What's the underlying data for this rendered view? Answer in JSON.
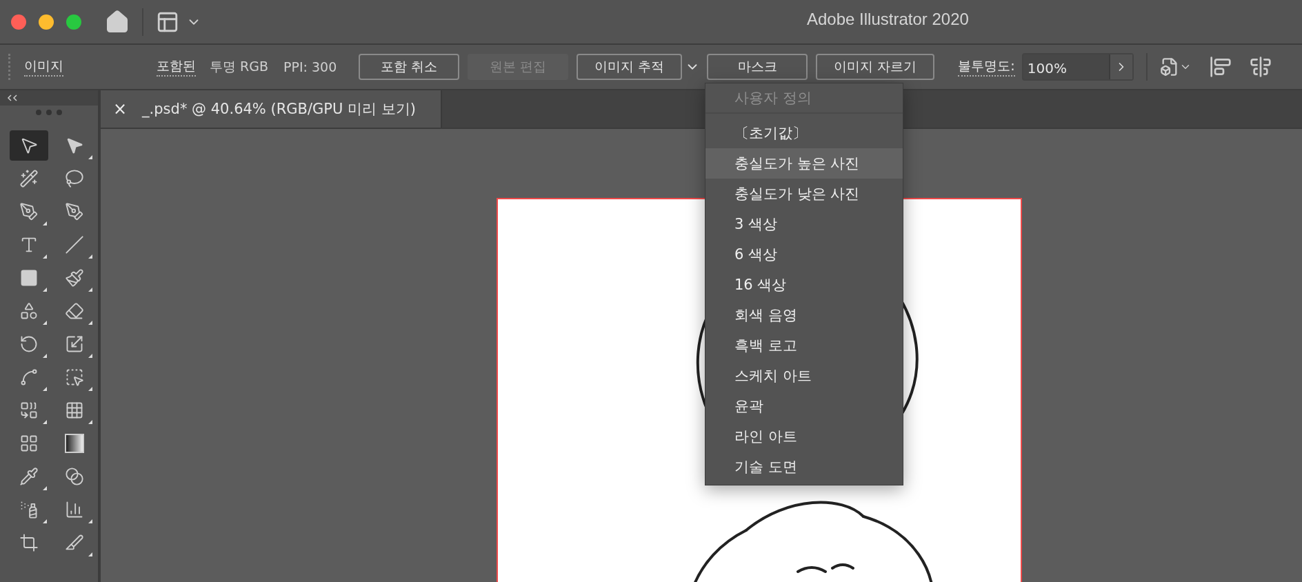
{
  "window": {
    "title": "Adobe Illustrator 2020"
  },
  "control_bar": {
    "label": "이미지",
    "status": "포함된",
    "color_mode": "투명 RGB",
    "ppi": "PPI: 300",
    "buttons": [
      {
        "label": "포함 취소",
        "disabled": false,
        "has_menu": false
      },
      {
        "label": "원본 편집",
        "disabled": true,
        "has_menu": false
      },
      {
        "label": "이미지 추적",
        "disabled": false,
        "has_menu": true
      },
      {
        "label": "마스크",
        "disabled": false,
        "has_menu": false
      },
      {
        "label": "이미지 자르기",
        "disabled": false,
        "has_menu": false
      }
    ],
    "opacity_label": "불투명도:",
    "opacity_value": "100%"
  },
  "document_tab": {
    "close": "×",
    "title": "_.psd* @ 40.64% (RGB/GPU 미리 보기)"
  },
  "tools": [
    {
      "selected": true,
      "flyout": false
    },
    {
      "selected": false,
      "flyout": true
    },
    {
      "selected": false,
      "flyout": false
    },
    {
      "selected": false,
      "flyout": false
    },
    {
      "selected": false,
      "flyout": true
    },
    {
      "selected": false,
      "flyout": false
    },
    {
      "selected": false,
      "flyout": true
    },
    {
      "selected": false,
      "flyout": true
    },
    {
      "selected": false,
      "flyout": true
    },
    {
      "selected": false,
      "flyout": true
    },
    {
      "selected": false,
      "flyout": true
    },
    {
      "selected": false,
      "flyout": true
    },
    {
      "selected": false,
      "flyout": true
    },
    {
      "selected": false,
      "flyout": true
    },
    {
      "selected": false,
      "flyout": true
    },
    {
      "selected": false,
      "flyout": true
    },
    {
      "selected": false,
      "flyout": true
    },
    {
      "selected": false,
      "flyout": true
    },
    {
      "selected": false,
      "flyout": false
    },
    {
      "selected": false,
      "flyout": false
    },
    {
      "selected": false,
      "flyout": true
    },
    {
      "selected": false,
      "flyout": false
    },
    {
      "selected": false,
      "flyout": true
    },
    {
      "selected": false,
      "flyout": true
    },
    {
      "selected": false,
      "flyout": false
    },
    {
      "selected": false,
      "flyout": true
    }
  ],
  "trace_menu": {
    "header": "사용자 정의",
    "items": [
      {
        "label": "〔초기값〕",
        "selected": false
      },
      {
        "label": "충실도가 높은 사진",
        "selected": true
      },
      {
        "label": "충실도가 낮은 사진",
        "selected": false
      },
      {
        "label": "3 색상",
        "selected": false
      },
      {
        "label": "6 색상",
        "selected": false
      },
      {
        "label": "16 색상",
        "selected": false
      },
      {
        "label": "회색 음영",
        "selected": false
      },
      {
        "label": "흑백 로고",
        "selected": false
      },
      {
        "label": "스케치 아트",
        "selected": false
      },
      {
        "label": "윤곽",
        "selected": false
      },
      {
        "label": "라인 아트",
        "selected": false
      },
      {
        "label": "기술 도면",
        "selected": false
      }
    ]
  }
}
